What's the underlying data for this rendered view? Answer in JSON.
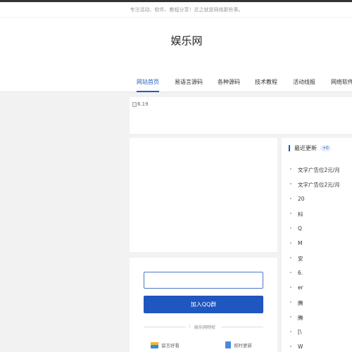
{
  "header": {
    "tagline": "专注活动、软件、教程分享！总之就是网络那些事。",
    "site_title": "娱乐网"
  },
  "nav": {
    "items": [
      {
        "label": "网站首页",
        "active": true
      },
      {
        "label": "易语言源码",
        "active": false
      },
      {
        "label": "各种源码",
        "active": false
      },
      {
        "label": "技术教程",
        "active": false
      },
      {
        "label": "活动线报",
        "active": false
      },
      {
        "label": "网络软件",
        "active": false
      }
    ]
  },
  "banner": {
    "alt_text": "6.19"
  },
  "qq_panel": {
    "input_value": "",
    "button_label": "加入QQ群",
    "feature_dot": "|",
    "feature_title": "娱乐网特权",
    "features": [
      {
        "label": "留言好看",
        "icon": "mail-icon"
      },
      {
        "label": "按时更新",
        "icon": "document-icon"
      }
    ]
  },
  "recent": {
    "title": "最近更新",
    "badge": "+0",
    "items": [
      "文字广告位2元/月",
      "文字广告位2元/月",
      "20",
      "科",
      "Q",
      "M",
      "安",
      "6.",
      "er",
      "腾",
      "腾",
      "[\\",
      "W"
    ]
  },
  "colors": {
    "accent": "#1f56bf",
    "background": "#f2f2f2",
    "panel": "#ffffff"
  }
}
